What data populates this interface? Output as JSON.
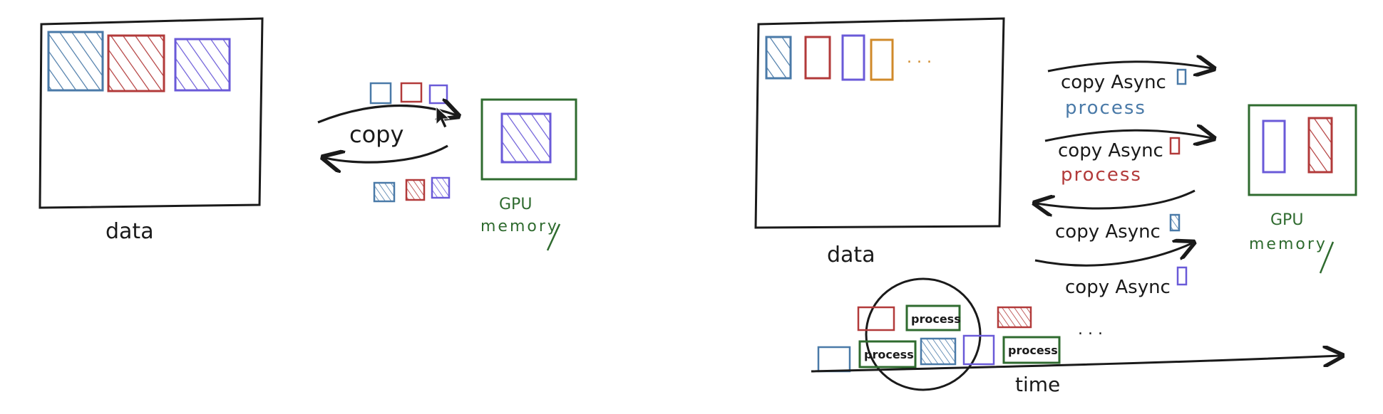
{
  "colors": {
    "ink": "#1a1a1a",
    "blue": "#4a7aa8",
    "red": "#b23a3a",
    "purple": "#6a5ad8",
    "orange": "#d08a2a",
    "green": "#2f6b2f"
  },
  "left_panel": {
    "data_label": "data",
    "copy_label": "copy",
    "gpu_label_line1": "GPU",
    "gpu_label_line2": "memory"
  },
  "right_panel": {
    "data_label": "data",
    "ellipsis": ". . .",
    "copy_async_1": "copy Async",
    "process_1": "process",
    "copy_async_2": "copy Async",
    "process_2": "process",
    "copy_async_3": "copy Async",
    "copy_async_4": "copy Async",
    "gpu_label_line1": "GPU",
    "gpu_label_line2": "memory"
  },
  "timeline": {
    "process_a": "process",
    "process_b": "process",
    "process_c": "process",
    "ellipsis": ". . .",
    "time_label": "time"
  }
}
